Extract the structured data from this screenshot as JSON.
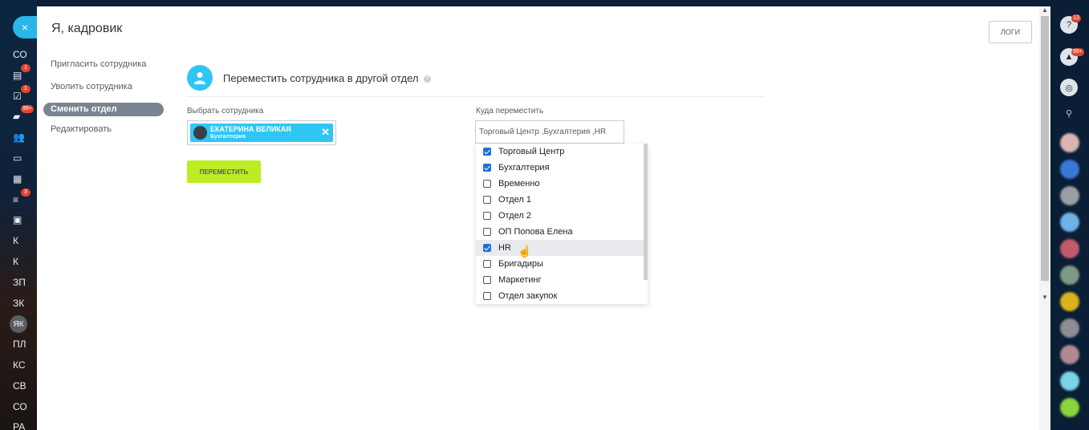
{
  "header": {
    "title": "Я, кадровик",
    "logs_label": "ЛОГИ",
    "close_glyph": "×"
  },
  "menu": [
    {
      "label": "Пригласить сотрудника",
      "active": false
    },
    {
      "label": "Уволить сотрудника",
      "active": false
    },
    {
      "label": "Сменить отдел",
      "active": true
    },
    {
      "label": "Редактировать",
      "active": false
    }
  ],
  "section": {
    "title": "Переместить сотрудника в другой отдел",
    "help": "?"
  },
  "employee": {
    "label": "Выбрать сотрудника",
    "name": "ЕКАТЕРИНА ВЕЛИКАЯ",
    "dept": "Бухгалтерия",
    "remove": "✕"
  },
  "move_button": "ПЕРЕМЕСТИТЬ",
  "destination": {
    "label": "Куда переместить",
    "value": "Торговый Центр ,Бухгалтерия ,HR",
    "options": [
      {
        "label": "Торговый Центр",
        "checked": true
      },
      {
        "label": "Бухгалтерия",
        "checked": true
      },
      {
        "label": "Временно",
        "checked": false
      },
      {
        "label": "Отдел 1",
        "checked": false
      },
      {
        "label": "Отдел 2",
        "checked": false
      },
      {
        "label": "ОП Попова Елена",
        "checked": false
      },
      {
        "label": "HR",
        "checked": true
      },
      {
        "label": "Бригадиры",
        "checked": false
      },
      {
        "label": "Маркетинг",
        "checked": false
      },
      {
        "label": "Отдел закупок",
        "checked": false
      }
    ]
  },
  "left_nav": [
    {
      "text": "СО"
    },
    {
      "text": "▤",
      "badge": "1"
    },
    {
      "text": "☑",
      "badge": "1"
    },
    {
      "text": "▰",
      "badge": "99+"
    },
    {
      "text": "👥"
    },
    {
      "text": "▭"
    },
    {
      "text": "▦"
    },
    {
      "text": "≡",
      "badge": "3"
    },
    {
      "text": "▣"
    },
    {
      "text": "К"
    },
    {
      "text": "К"
    },
    {
      "text": "ЗП"
    },
    {
      "text": "ЗК"
    },
    {
      "text": "ЯК",
      "avatar": true
    },
    {
      "text": "ПЛ"
    },
    {
      "text": "КС"
    },
    {
      "text": "СВ"
    },
    {
      "text": "СО"
    },
    {
      "text": "РА"
    }
  ],
  "right_bar": {
    "help_badge": "13",
    "notif_badge": "99+",
    "colors": [
      "#d9b7b0",
      "#3a78d6",
      "#9a9fa5",
      "#6fb3e8",
      "#c25a6d",
      "#7c9a86",
      "#d8b21f",
      "#8d8f94",
      "#b08a90",
      "#7bd3e6",
      "#8bd43c"
    ]
  }
}
